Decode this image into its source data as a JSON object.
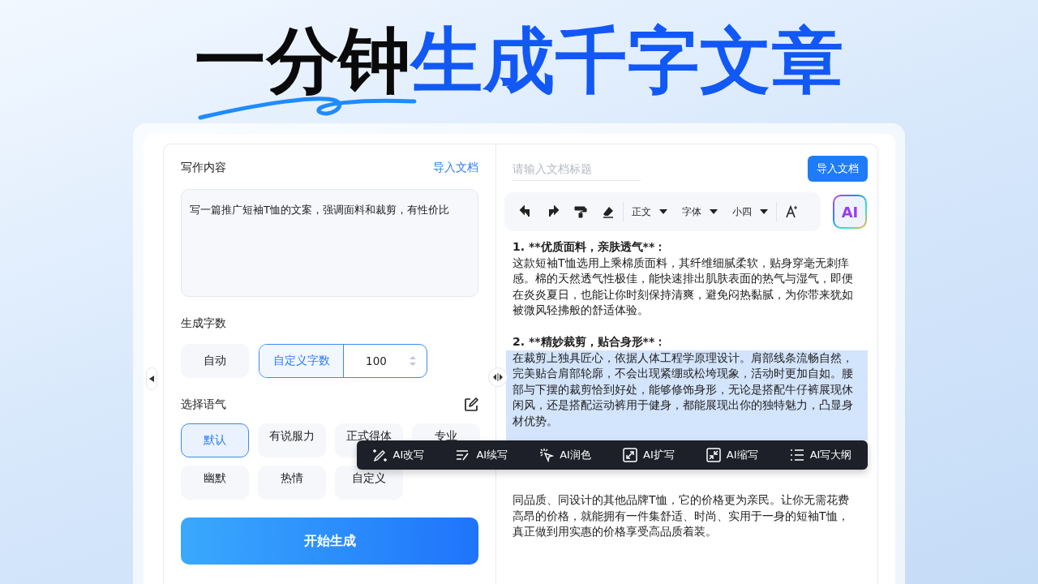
{
  "headline": [
    {
      "text": "一分钟",
      "kind": "plain"
    },
    {
      "text": "生成千字文章",
      "kind": "accent"
    }
  ],
  "left": {
    "content_label": "写作内容",
    "import_link": "导入文档",
    "prompt": "写一篇推广短袖T恤的文案，强调面料和裁剪，有性价比",
    "count_label": "生成字数",
    "count_options": [
      {
        "kind": "chip",
        "label": "自动",
        "selected": false
      },
      {
        "kind": "custom",
        "label": "自定义字数",
        "selected": true,
        "value": "100"
      }
    ],
    "tone_label": "选择语气",
    "tones": [
      {
        "label": "默认",
        "selected": true
      },
      {
        "label": "有说服力",
        "selected": false
      },
      {
        "label": "正式得体",
        "selected": false
      },
      {
        "label": "专业",
        "selected": false
      },
      {
        "label": "幽默",
        "selected": false
      },
      {
        "label": "热情",
        "selected": false
      },
      {
        "label": "自定义",
        "selected": false
      }
    ],
    "generate_button": "开始生成"
  },
  "right": {
    "title_placeholder": "请输入文档标题",
    "import_button": "导入文档",
    "toolbar": [
      {
        "kind": "undo"
      },
      {
        "kind": "redo"
      },
      {
        "kind": "painter"
      },
      {
        "kind": "eraser"
      },
      {
        "kind": "dropdown",
        "label": "正文"
      },
      {
        "kind": "dropdown",
        "label": "字体"
      },
      {
        "kind": "dropdown",
        "label": "小四"
      },
      {
        "kind": "fontsize"
      }
    ],
    "ai_button": "AI",
    "paragraphs": [
      {
        "heading": "1. **优质面料，亲肤透气**：",
        "body": "这款短袖T恤选用上乘棉质面料，其纤维细腻柔软，贴身穿毫无刺痒感。棉的天然透气性极佳，能快速排出肌肤表面的热气与湿气，即便在炎炎夏日，也能让你时刻保持清爽，避免闷热黏腻，为你带来犹如被微风轻拂般的舒适体验。",
        "highlighted": false
      },
      {
        "heading": "2. **精妙裁剪，贴合身形**：",
        "body": "在裁剪上独具匠心，依据人体工程学原理设计。肩部线条流畅自然，完美贴合肩部轮廓，不会出现紧绷或松垮现象，活动时更加自如。腰部与下摆的裁剪恰到好处，能够修饰身形，无论是搭配牛仔裤展现休闲风，还是搭配运动裤用于健身，都能展现出你的独特魅力，凸显身材优势。",
        "highlighted": true
      },
      {
        "body": "同品质、同设计的其他品牌T恤，它的价格更为亲民。让你无需花费高昂的价格，就能拥有一件集舒适、时尚、实用于一身的短袖T恤，真正做到用实惠的价格享受高品质着装。",
        "highlighted": false
      }
    ],
    "floating_menu": [
      {
        "kind": "rewrite",
        "label": "AI改写"
      },
      {
        "kind": "continue",
        "label": "AI续写"
      },
      {
        "kind": "polish",
        "label": "AI润色"
      },
      {
        "kind": "expand",
        "label": "AI扩写"
      },
      {
        "kind": "shrink",
        "label": "AI缩写"
      },
      {
        "kind": "outline",
        "label": "AI写大纲"
      }
    ]
  }
}
